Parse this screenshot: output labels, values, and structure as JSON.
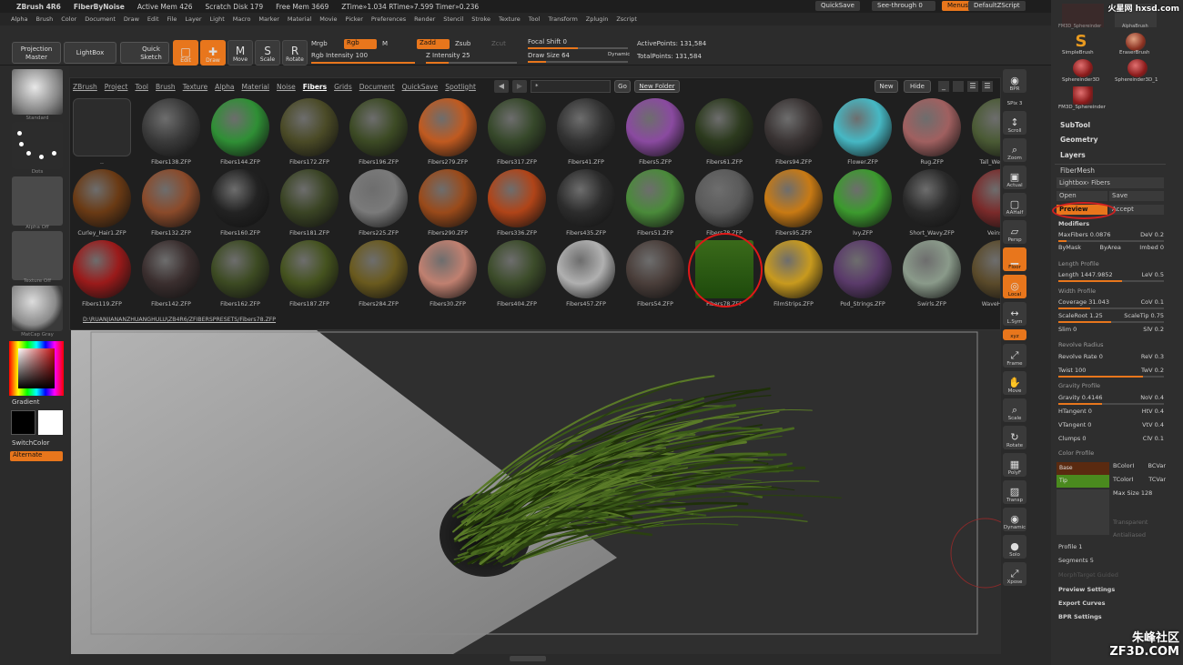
{
  "titlebar": {
    "app": "ZBrush 4R6",
    "doc": "FiberByNoise",
    "active_mem": "Active Mem 426",
    "scratch": "Scratch Disk 179",
    "free_mem": "Free Mem 3669",
    "ztime": "ZTime»1.034 RTime»7.599 Timer»0.236",
    "quicksave": "QuickSave",
    "see_through": "See-through",
    "see_through_value": "0",
    "menus": "Menus",
    "script": "DefaultZScript"
  },
  "menubar": [
    "Alpha",
    "Brush",
    "Color",
    "Document",
    "Draw",
    "Edit",
    "File",
    "Layer",
    "Light",
    "Macro",
    "Marker",
    "Material",
    "Movie",
    "Picker",
    "Preferences",
    "Render",
    "Stencil",
    "Stroke",
    "Texture",
    "Tool",
    "Transform",
    "Zplugin",
    "Zscript"
  ],
  "toolbar": {
    "projection_master": "Projection Master",
    "lightbox": "LightBox",
    "quick_sketch": "Quick Sketch",
    "edit": "Edit",
    "draw": "Draw",
    "move": "Move",
    "scale": "Scale",
    "rotate": "Rotate",
    "mrgb": "Mrgb",
    "rgb": "Rgb",
    "m": "M",
    "zadd": "Zadd",
    "zsub": "Zsub",
    "zcut": "Zcut",
    "rgb_intensity": "Rgb Intensity 100",
    "z_intensity": "Z Intensity 25",
    "focal_shift": "Focal Shift 0",
    "draw_size": "Draw Size 64",
    "dynamic": "Dynamic",
    "active_points": "ActivePoints: 131,584",
    "total_points": "TotalPoints: 131,584"
  },
  "left": {
    "standard": "Standard",
    "dots": "Dots",
    "alpha": "Alpha  Off",
    "texture": "Texture  Off",
    "matcap": "MatCap Gray",
    "gradient": "Gradient",
    "switch_color": "SwitchColor",
    "alternate": "Alternate"
  },
  "lightbox": {
    "nav": [
      "ZBrush",
      "Project",
      "Tool",
      "Brush",
      "Texture",
      "Alpha",
      "Material",
      "Noise",
      "Fibers",
      "Grids",
      "Document",
      "QuickSave",
      "Spotlight"
    ],
    "selected_nav": "Fibers",
    "search": "*",
    "go": "Go",
    "new_folder": "New Folder",
    "new": "New",
    "hide": "Hide",
    "path": "D:\\RUANJIANANZHUANGHULU\\ZB4R6/ZFIBERSPRESETS/Fibers78.ZFP",
    "rows": [
      [
        {
          "n": "..",
          "c": "folder"
        },
        {
          "n": "Fibers138.ZFP",
          "c": "#3a3a3a"
        },
        {
          "n": "Fibers144.ZFP",
          "c": "#2f8f35"
        },
        {
          "n": "Fibers172.ZFP",
          "c": "#4a4a26"
        },
        {
          "n": "Fibers196.ZFP",
          "c": "#3c4a24"
        },
        {
          "n": "Fibers279.ZFP",
          "c": "#c05a20"
        },
        {
          "n": "Fibers317.ZFP",
          "c": "#36482a"
        },
        {
          "n": "Fibers41.ZFP",
          "c": "#333333"
        },
        {
          "n": "Fibers5.ZFP",
          "c": "#8a4aa0"
        },
        {
          "n": "Fibers61.ZFP",
          "c": "#2c3a1e"
        },
        {
          "n": "Fibers94.ZFP",
          "c": "#3a3434"
        },
        {
          "n": "Flower.ZFP",
          "c": "#46b8c4"
        },
        {
          "n": "Rug.ZFP",
          "c": "#a06060"
        },
        {
          "n": "Tall_Weeds.ZFP",
          "c": "#4a5a34"
        }
      ],
      [
        {
          "n": "Curley_Hair1.ZFP",
          "c": "#6a3a14"
        },
        {
          "n": "Fibers132.ZFP",
          "c": "#8a4a2a"
        },
        {
          "n": "Fibers160.ZFP",
          "c": "#222222"
        },
        {
          "n": "Fibers181.ZFP",
          "c": "#3a4424"
        },
        {
          "n": "Fibers225.ZFP",
          "c": "#7a7a7a"
        },
        {
          "n": "Fibers290.ZFP",
          "c": "#9a4a1a"
        },
        {
          "n": "Fibers336.ZFP",
          "c": "#b04418"
        },
        {
          "n": "Fibers435.ZFP",
          "c": "#2c2c2c"
        },
        {
          "n": "Fibers51.ZFP",
          "c": "#4a8a3a"
        },
        {
          "n": "Fibers78.ZFP",
          "c": "#5a5a5a"
        },
        {
          "n": "Fibers95.ZFP",
          "c": "#c87a14"
        },
        {
          "n": "Ivy.ZFP",
          "c": "#3c9a2e"
        },
        {
          "n": "Short_Wavy.ZFP",
          "c": "#2a2a2a"
        },
        {
          "n": "Veins.ZFP",
          "c": "#7a2a2a"
        }
      ],
      [
        {
          "n": "Fibers119.ZFP",
          "c": "#9a1a1a"
        },
        {
          "n": "Fibers142.ZFP",
          "c": "#3a2e2e"
        },
        {
          "n": "Fibers162.ZFP",
          "c": "#3c4a22"
        },
        {
          "n": "Fibers187.ZFP",
          "c": "#44521e"
        },
        {
          "n": "Fibers284.ZFP",
          "c": "#6a5a1e"
        },
        {
          "n": "Fibers30.ZFP",
          "c": "#c08070"
        },
        {
          "n": "Fibers404.ZFP",
          "c": "#3c4c2a"
        },
        {
          "n": "Fibers457.ZFP",
          "c": "#b0b0b0"
        },
        {
          "n": "Fibers54.ZFP",
          "c": "#4a3e3a"
        },
        {
          "n": "Fibers78.ZFP",
          "c": "#2e5a14"
        },
        {
          "n": "FilmStrips.ZFP",
          "c": "#c89a1e"
        },
        {
          "n": "Pod_Strings.ZFP",
          "c": "#5a3a6a"
        },
        {
          "n": "Swirls.ZFP",
          "c": "#8a9a8a"
        },
        {
          "n": "WaveHair.ZFP",
          "c": "#5a4a2a"
        }
      ]
    ]
  },
  "rstrip": [
    "BPR",
    "SPix 3",
    "Scroll",
    "Zoom",
    "Actual",
    "AAHalf",
    "Persp",
    "Floor",
    "Local",
    "L.Sym",
    "xyz",
    "Frame",
    "Move",
    "Scale",
    "Rotate",
    "PolyF",
    "Transp",
    "Dynamic",
    "Solo",
    "Xpose"
  ],
  "rpanel": {
    "brushes": [
      "FM3D_Sphereinder",
      "AlphaBrush",
      "SimpleBrush",
      "EraserBrush",
      "Sphereinder3D",
      "Sphereinder3D_1",
      "FM3D_Sphereinder"
    ],
    "subtool": "SubTool",
    "geometry": "Geometry",
    "layers": "Layers",
    "fibermesh": "FiberMesh",
    "lightbox_fibers": "Lightbox› Fibers",
    "open": "Open",
    "save": "Save",
    "preview": "Preview",
    "accept": "Accept",
    "modifiers": "Modifiers",
    "maxfibers": "MaxFibers 0.0876",
    "dev": "DeV 0.2",
    "bymask": "ByMask",
    "byarea": "ByArea",
    "imbed": "Imbed 0",
    "length_profile": "Length Profile",
    "length": "Length 1447.9852",
    "lev": "LeV 0.5",
    "width_profile": "Width Profile",
    "coverage": "Coverage 31.043",
    "cov": "CoV 0.1",
    "scaleroot": "ScaleRoot 1.25",
    "scaletip": "ScaleTip 0.75",
    "slim": "Slim 0",
    "siv": "SlV 0.2",
    "revolve_radius": "Revolve Radius",
    "revolve_rate": "Revolve Rate 0",
    "rev": "ReV 0.3",
    "twist": "Twist 100",
    "twv": "TwV 0.2",
    "gravity_profile": "Gravity Profile",
    "gravity": "Gravity 0.4146",
    "nov": "NoV 0.4",
    "htangent": "HTangent 0",
    "htv": "HtV 0.4",
    "vtangent": "VTangent 0",
    "vtv": "VtV 0.4",
    "clumps": "Clumps 0",
    "clv": "ClV 0.1",
    "color_profile": "Color Profile",
    "base": "Base",
    "tip": "Tip",
    "bcolor": "BColorI",
    "bcvar": "BCVar",
    "tcolor": "TColorI",
    "tcvar": "TCVar",
    "max_size": "Max Size 128",
    "transparent": "Transparent",
    "antialiased": "Antialiased",
    "profile": "Profile 1",
    "segments": "Segments 5",
    "morph": "MorphTarget Guided",
    "preview_settings": "Preview Settings",
    "export_curves": "Export Curves",
    "bpr_settings": "BPR Settings",
    "base_color": "#5a2a10",
    "tip_color": "#4a8a1e"
  },
  "watermark_top": "火星网 hxsd.com",
  "watermark_bottom": "朱峰社区 ZF3D.COM"
}
